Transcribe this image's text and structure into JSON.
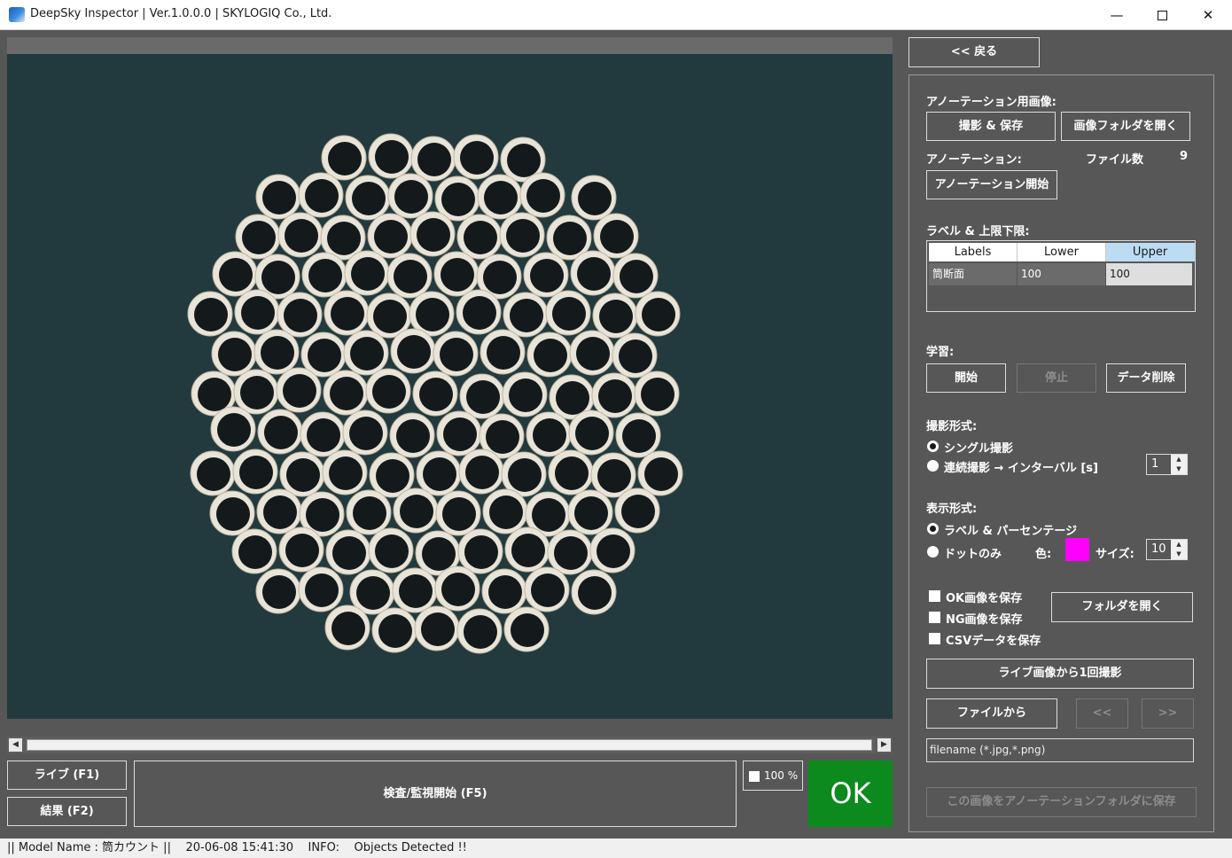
{
  "window": {
    "title": "DeepSky Inspector | Ver.1.0.0.0 | SKYLOGIQ Co., Ltd.",
    "minimize": "—",
    "close": "✕"
  },
  "viewer": {
    "image": "pipe-bundle-photo",
    "scroll_left": "◀",
    "scroll_right": "▶"
  },
  "controls": {
    "live": "ライブ (F1)",
    "result": "結果 (F2)",
    "inspect": "検査/監視開始 (F5)",
    "zoom": "100 %",
    "verdict": "OK",
    "verdict_color": "#0d8a1d"
  },
  "status": {
    "text": "|| Model Name : 筒カウント ||    20-06-08 15:41:30    INFO:    Objects Detected !!"
  },
  "panel": {
    "back": "<< 戻る",
    "annot_image_label": "アノーテーション用画像:",
    "capture_save": "撮影 & 保存",
    "open_image_folder": "画像フォルダを開く",
    "annotation_label": "アノーテーション:",
    "file_count_label": "ファイル数",
    "file_count": "9",
    "start_annotation": "アノーテーション開始",
    "limits_label": "ラベル & 上限下限:",
    "grid": {
      "headers": [
        "Labels",
        "Lower",
        "Upper"
      ],
      "rows": [
        [
          "筒断面",
          "100",
          "100"
        ]
      ]
    },
    "learning_label": "学習:",
    "learn_start": "開始",
    "learn_stop": "停止",
    "delete_data": "データ削除",
    "capture_mode_label": "撮影形式:",
    "single": "シングル撮影",
    "continuous": "連続撮影 → インターバル [s]",
    "interval": "1",
    "display_mode_label": "表示形式:",
    "label_percent": "ラベル & パーセンテージ",
    "dot_only": "ドットのみ",
    "color_label": "色:",
    "dot_color": "#ff00ff",
    "size_label": "サイズ:",
    "size": "10",
    "save_ok": "OK画像を保存",
    "save_ng": "NG画像を保存",
    "save_csv": "CSVデータを保存",
    "open_folder": "フォルダを開く",
    "live_capture_once": "ライブ画像から1回撮影",
    "from_file": "ファイルから",
    "prev": "<<",
    "next": ">>",
    "filename": "filename (*.jpg,*.png)",
    "save_to_annot": "この画像をアノーテーションフォルダに保存",
    "spin_up": "▲",
    "spin_down": "▼"
  }
}
